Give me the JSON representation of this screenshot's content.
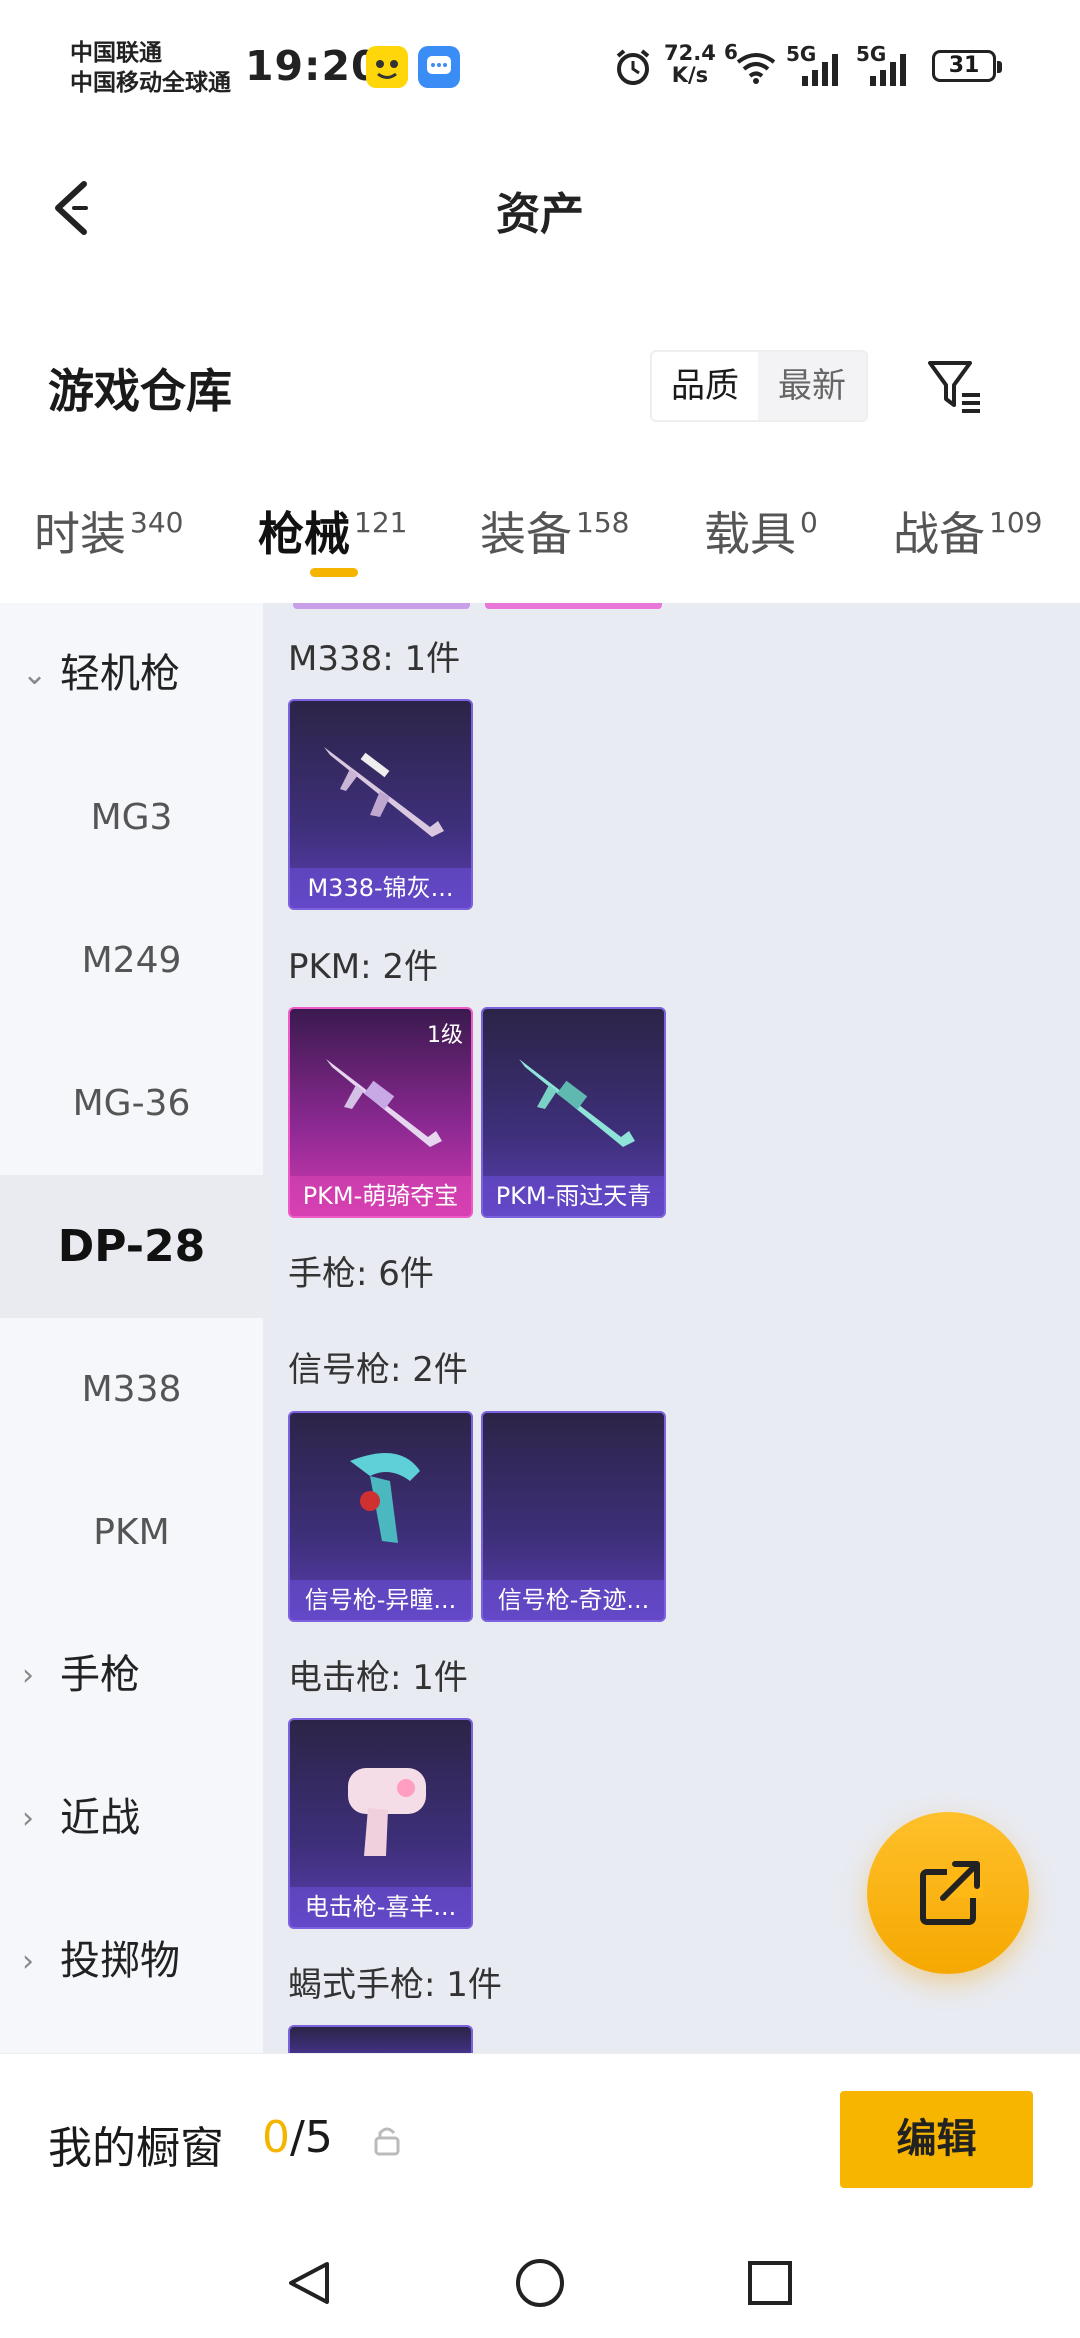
{
  "status_bar": {
    "carrier1": "中国联通",
    "carrier2": "中国移动全球通",
    "time": "19:20",
    "net_speed_value": "72.4",
    "net_speed_unit": "K/s",
    "wifi_label": "6",
    "sig1_label": "5G",
    "sig2_label": "5G",
    "battery": "31"
  },
  "header": {
    "title": "资产"
  },
  "warehouse": {
    "title": "游戏仓库",
    "sort_options": [
      "品质",
      "最新"
    ]
  },
  "tabs": [
    {
      "label": "时装",
      "count": "340"
    },
    {
      "label": "枪械",
      "count": "121"
    },
    {
      "label": "装备",
      "count": "158"
    },
    {
      "label": "载具",
      "count": "0"
    },
    {
      "label": "战备",
      "count": "109"
    }
  ],
  "left_nav": {
    "group_lmg": "轻机枪",
    "items": [
      "MG3",
      "M249",
      "MG-36",
      "DP-28",
      "M338",
      "PKM"
    ],
    "selected": "DP-28",
    "group_pistol": "手枪",
    "group_melee": "近战",
    "group_throw": "投掷物"
  },
  "sections": {
    "m338": {
      "title": "M338: 1件",
      "items": [
        "M338-锦灰..."
      ]
    },
    "pkm": {
      "title": "PKM: 2件",
      "items": [
        "PKM-萌骑夺宝",
        "PKM-雨过天青"
      ],
      "level": "1级"
    },
    "pistol": {
      "title": "手枪: 6件"
    },
    "flare": {
      "title": "信号枪: 2件",
      "items": [
        "信号枪-异瞳...",
        "信号枪-奇迹..."
      ]
    },
    "stun": {
      "title": "电击枪: 1件",
      "items": [
        "电击枪-喜羊..."
      ]
    },
    "scorpion": {
      "title": "蝎式手枪: 1件"
    }
  },
  "showcase": {
    "label": "我的橱窗",
    "used": "0",
    "total": "/5",
    "edit": "编辑"
  },
  "colors": {
    "accent": "#f5b400",
    "card_purple": "#3e2f7a",
    "card_pink": "#d23bb0"
  }
}
